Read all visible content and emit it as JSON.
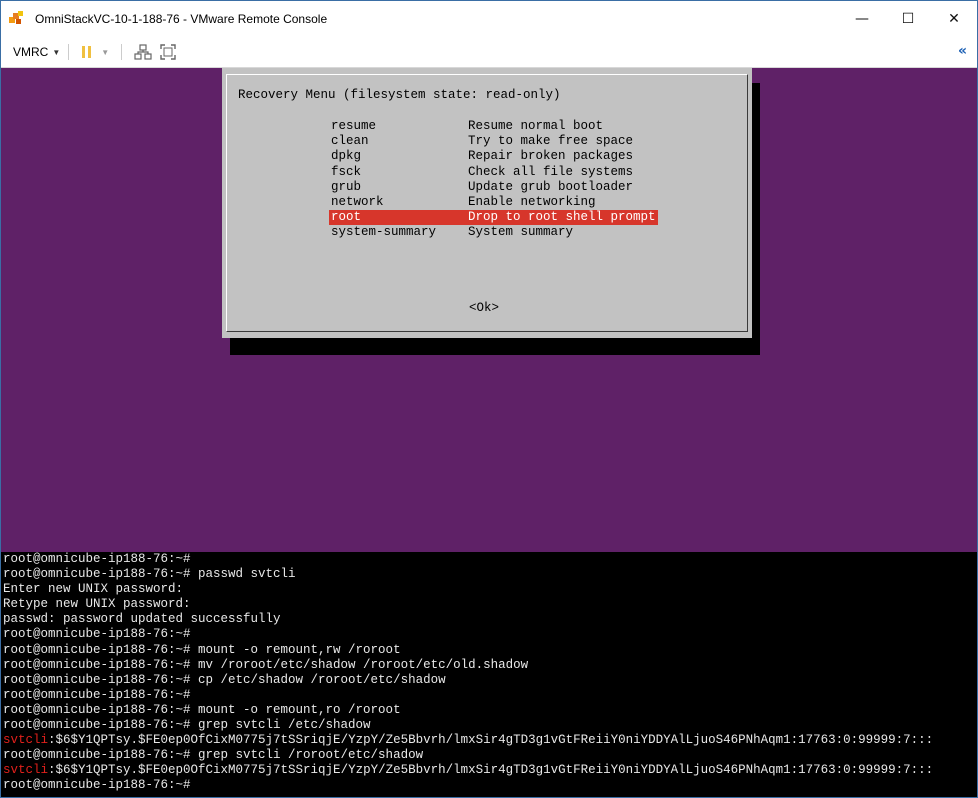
{
  "window": {
    "title": "OmniStackVC-10-1-188-76 - VMware Remote Console",
    "minimize": "—",
    "maximize": "☐",
    "close": "✕"
  },
  "toolbar": {
    "vmrc_label": "VMRC",
    "collapse": "«"
  },
  "recovery_menu": {
    "title": "Recovery Menu (filesystem state: read-only)",
    "items": [
      {
        "key": "resume",
        "desc": "Resume normal boot"
      },
      {
        "key": "clean",
        "desc": "Try to make free space"
      },
      {
        "key": "dpkg",
        "desc": "Repair broken packages"
      },
      {
        "key": "fsck",
        "desc": "Check all file systems"
      },
      {
        "key": "grub",
        "desc": "Update grub bootloader"
      },
      {
        "key": "network",
        "desc": "Enable networking"
      },
      {
        "key": "root",
        "desc": "Drop to root shell prompt",
        "selected": true
      },
      {
        "key": "system-summary",
        "desc": "System summary"
      }
    ],
    "ok_button": "<Ok>"
  },
  "terminal": {
    "prompt": "root@omnicube-ip188-76:~#",
    "lines": [
      {
        "text": "root@omnicube-ip188-76:~#"
      },
      {
        "text": "root@omnicube-ip188-76:~# passwd svtcli"
      },
      {
        "text": "Enter new UNIX password:"
      },
      {
        "text": "Retype new UNIX password:"
      },
      {
        "text": "passwd: password updated successfully"
      },
      {
        "text": "root@omnicube-ip188-76:~#"
      },
      {
        "text": "root@omnicube-ip188-76:~# mount -o remount,rw /roroot"
      },
      {
        "text": "root@omnicube-ip188-76:~# mv /roroot/etc/shadow /roroot/etc/old.shadow"
      },
      {
        "text": "root@omnicube-ip188-76:~# cp /etc/shadow /roroot/etc/shadow"
      },
      {
        "text": "root@omnicube-ip188-76:~#"
      },
      {
        "text": "root@omnicube-ip188-76:~# mount -o remount,ro /roroot"
      },
      {
        "text": "root@omnicube-ip188-76:~# grep svtcli /etc/shadow"
      },
      {
        "highlight": "svtcli",
        "text": ":$6$Y1QPTsy.$FE0ep0OfCixM0775j7tSSriqjE/YzpY/Ze5Bbvrh/lmxSir4gTD3g1vGtFReiiY0niYDDYAlLjuoS46PNhAqm1:17763:0:99999:7:::"
      },
      {
        "text": "root@omnicube-ip188-76:~# grep svtcli /roroot/etc/shadow"
      },
      {
        "highlight": "svtcli",
        "text": ":$6$Y1QPTsy.$FE0ep0OfCixM0775j7tSSriqjE/YzpY/Ze5Bbvrh/lmxSir4gTD3g1vGtFReiiY0niYDDYAlLjuoS46PNhAqm1:17763:0:99999:7:::"
      },
      {
        "text": "root@omnicube-ip188-76:~#"
      }
    ]
  },
  "colors": {
    "console_bg": "#5f2167",
    "dialog_bg": "#c2c2c2",
    "selection": "#d7362b",
    "highlight_text": "#e0201b"
  }
}
